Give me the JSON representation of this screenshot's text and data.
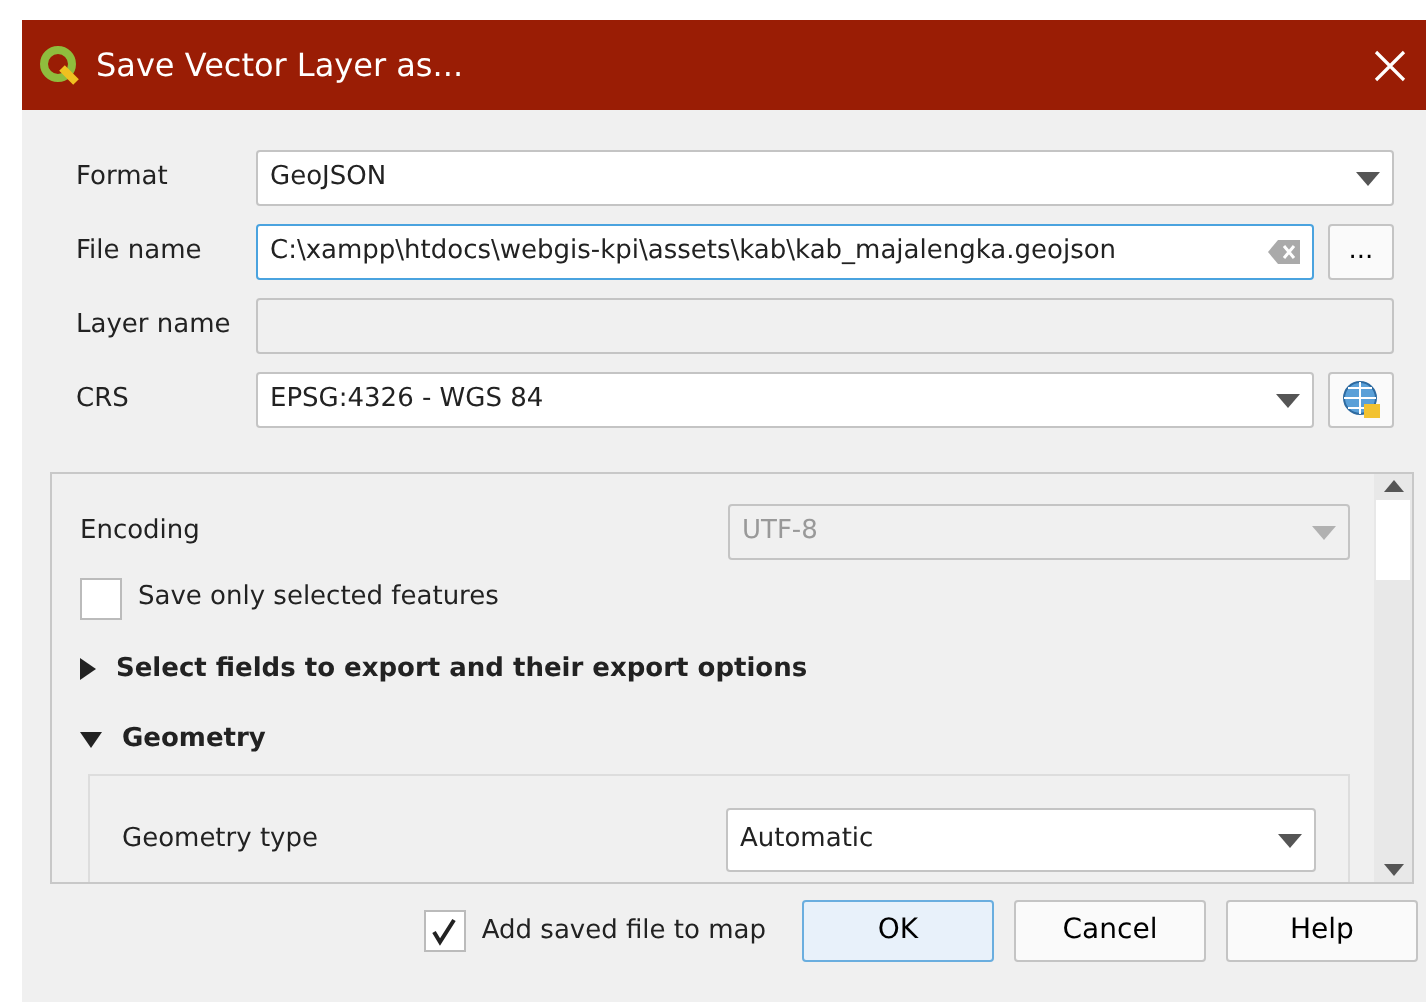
{
  "window": {
    "title": "Save Vector Layer as..."
  },
  "fields": [
    {
      "kind": "combo",
      "label": "Format",
      "value": "GeoJSON"
    },
    {
      "kind": "file",
      "label": "File name",
      "value": "C:\\xampp\\htdocs\\webgis-kpi\\assets\\kab\\kab_majalengka.geojson",
      "browse": "..."
    },
    {
      "kind": "text",
      "label": "Layer name"
    },
    {
      "kind": "crs",
      "label": "CRS",
      "value": "EPSG:4326 - WGS 84"
    }
  ],
  "options": {
    "encoding": {
      "label": "Encoding",
      "value": "UTF-8",
      "disabled": true
    },
    "save_selected": {
      "label": "Save only selected features",
      "checked": false
    },
    "sections": [
      {
        "label": "Select fields to export and their export options",
        "expanded": false
      },
      {
        "label": "Geometry",
        "expanded": true
      }
    ],
    "geometry_type": {
      "label": "Geometry type",
      "value": "Automatic"
    }
  },
  "footer": {
    "add_to_map": {
      "label": "Add saved file to map",
      "checked": true
    },
    "buttons": [
      {
        "label": "OK",
        "default": true
      },
      {
        "label": "Cancel",
        "default": false
      },
      {
        "label": "Help",
        "default": false
      }
    ]
  }
}
